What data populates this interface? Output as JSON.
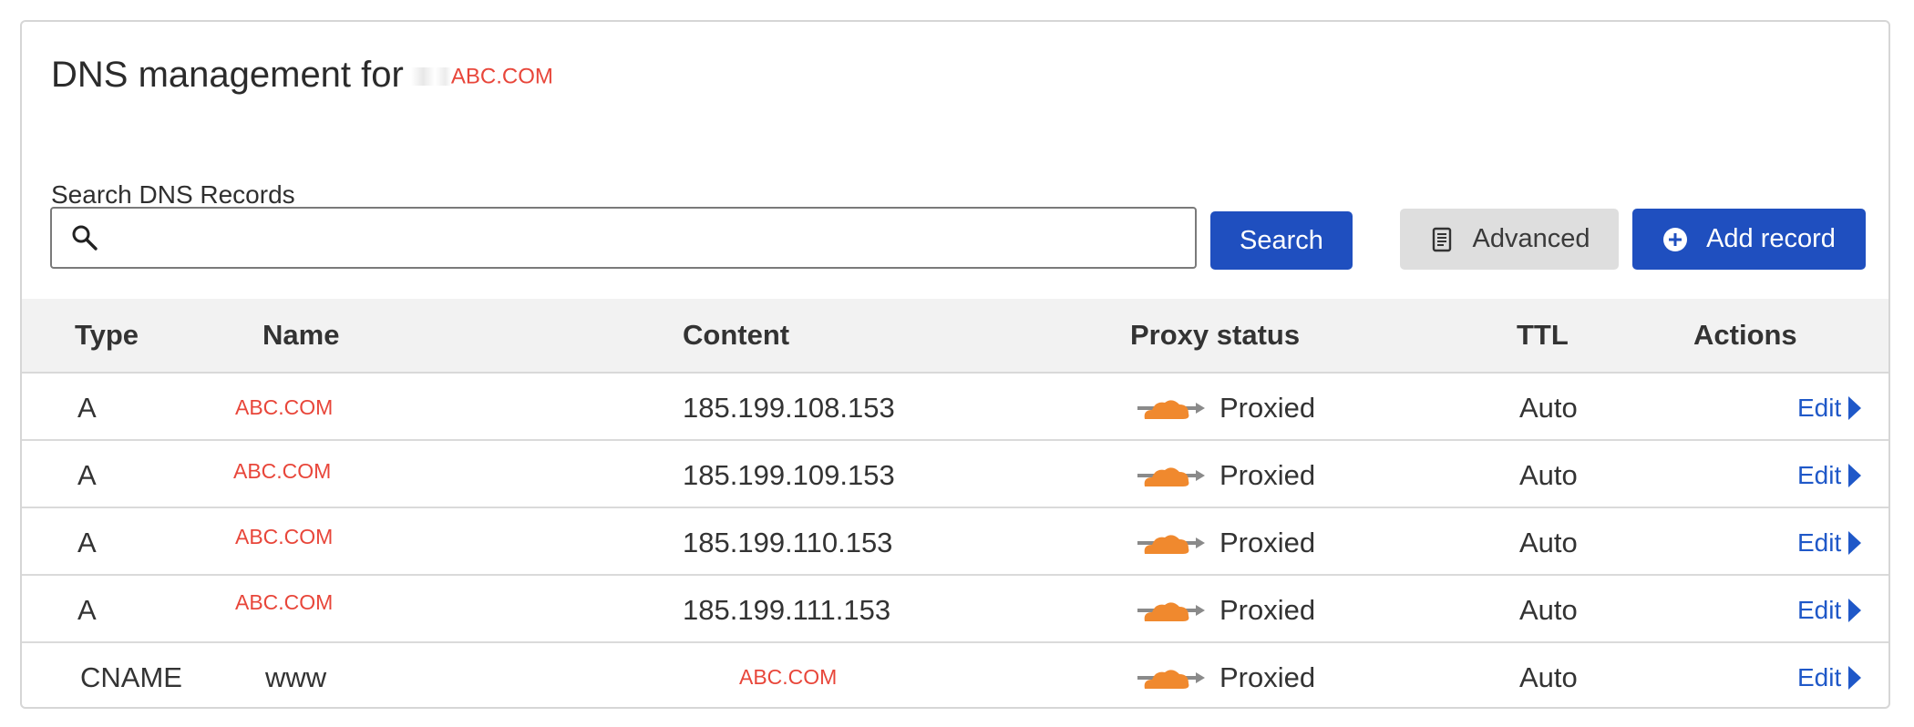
{
  "header": {
    "title_prefix": "DNS management for",
    "domain": "ABC.COM"
  },
  "search": {
    "label": "Search DNS Records",
    "value": "",
    "placeholder": "",
    "button_label": "Search"
  },
  "toolbar": {
    "advanced_label": "Advanced",
    "add_record_label": "Add record"
  },
  "table": {
    "columns": [
      "Type",
      "Name",
      "Content",
      "Proxy status",
      "TTL",
      "Actions"
    ],
    "rows": [
      {
        "type": "A",
        "name": "ABC.COM",
        "content": "185.199.108.153",
        "proxy": "Proxied",
        "ttl": "Auto",
        "action": "Edit"
      },
      {
        "type": "A",
        "name": "ABC.COM",
        "content": "185.199.109.153",
        "proxy": "Proxied",
        "ttl": "Auto",
        "action": "Edit"
      },
      {
        "type": "A",
        "name": "ABC.COM",
        "content": "185.199.110.153",
        "proxy": "Proxied",
        "ttl": "Auto",
        "action": "Edit"
      },
      {
        "type": "A",
        "name": "ABC.COM",
        "content": "185.199.111.153",
        "proxy": "Proxied",
        "ttl": "Auto",
        "action": "Edit"
      },
      {
        "type": "CNAME",
        "name": "www",
        "content": "ABC.COM",
        "proxy": "Proxied",
        "ttl": "Auto",
        "action": "Edit"
      }
    ]
  },
  "icons": {
    "search": "search-icon",
    "advanced": "document-icon",
    "add": "plus-circle-icon",
    "proxy": "cloud-icon",
    "edit": "caret-right-icon"
  },
  "colors": {
    "primary": "#1f4fbf",
    "link": "#1f58c8",
    "redaction": "#e8463a",
    "cloud": "#f0892e"
  }
}
